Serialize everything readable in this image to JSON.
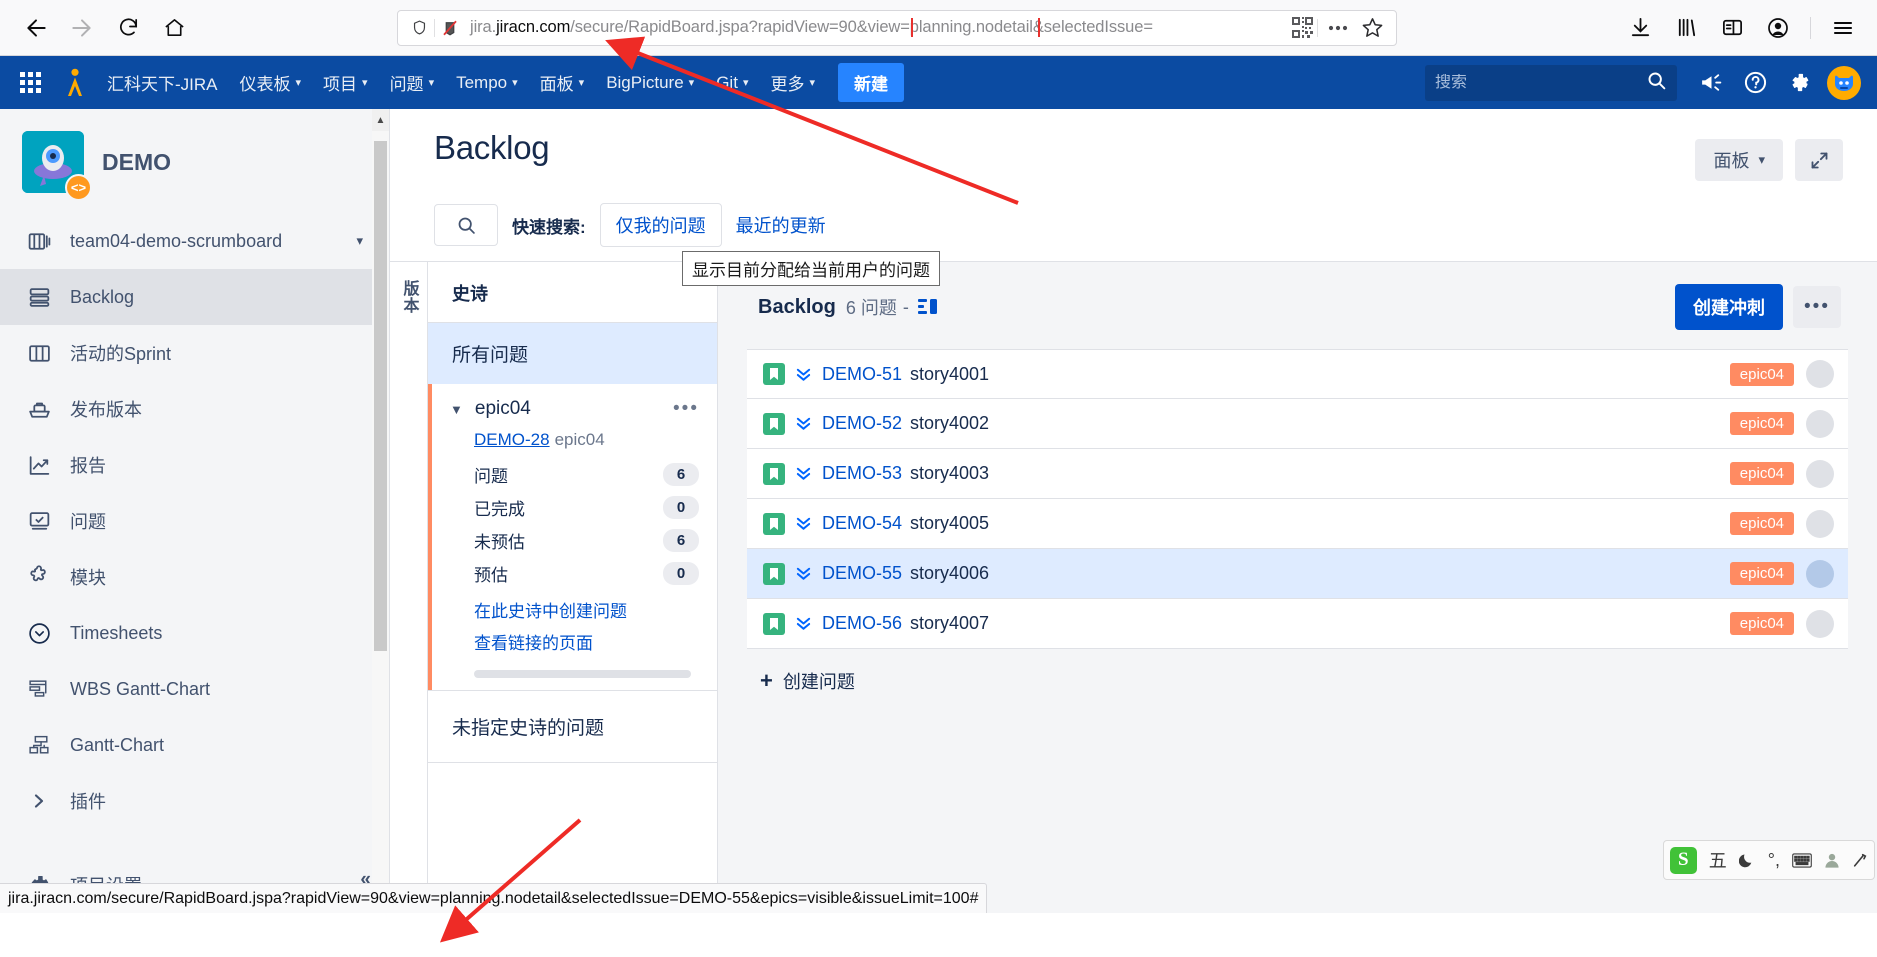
{
  "browser": {
    "back_title": "Back",
    "forward_title": "Forward",
    "reload_title": "Reload",
    "home_title": "Home",
    "url_full": "jira.jiracn.com/secure/RapidBoard.jspa?rapidView=90&view=planning.nodetail&selectedIssue=",
    "url_host_prefix": "jira.",
    "url_host_bold": "jiracn.com",
    "url_path": "/secure/RapidBoard.jspa?",
    "url_highlighted": "rapidView=90&",
    "url_tail": "view=planning.nodetail&selectedIssue=",
    "highlight_color": "#e8302d",
    "shield_title": "Tracking protection",
    "qr_title": "QR code",
    "more_title": "Page actions",
    "bookmark_title": "Bookmark this page",
    "downloads_title": "Downloads",
    "library_title": "Library",
    "sidebar_title": "Sidebar",
    "account_title": "Account",
    "menu_title": "Open application menu"
  },
  "jira_nav": {
    "brand": "汇科天下-JIRA",
    "items": [
      {
        "label": "仪表板",
        "has_caret": true
      },
      {
        "label": "项目",
        "has_caret": true
      },
      {
        "label": "问题",
        "has_caret": true
      },
      {
        "label": "Tempo",
        "has_caret": true
      },
      {
        "label": "面板",
        "has_caret": true
      },
      {
        "label": "BigPicture",
        "has_caret": true
      },
      {
        "label": "Git",
        "has_caret": true
      },
      {
        "label": "更多",
        "has_caret": true
      }
    ],
    "create_button": "新建",
    "search_placeholder": "搜索",
    "search_value": "",
    "icons": [
      "megaphone-icon",
      "help-icon",
      "gear-icon",
      "avatar"
    ],
    "bg_color": "#0b4ba2",
    "create_color": "#2684ff"
  },
  "sidebar": {
    "project_name": "DEMO",
    "board_selector": "team04-demo-scrumboard",
    "items": [
      {
        "label": "Backlog",
        "icon": "backlog-icon",
        "selected": true
      },
      {
        "label": "活动的Sprint",
        "icon": "board-icon",
        "selected": false
      },
      {
        "label": "发布版本",
        "icon": "releases-icon",
        "selected": false
      },
      {
        "label": "报告",
        "icon": "reports-icon",
        "selected": false
      },
      {
        "label": "问题",
        "icon": "issues-icon",
        "selected": false
      },
      {
        "label": "模块",
        "icon": "components-icon",
        "selected": false
      },
      {
        "label": "Timesheets",
        "icon": "clock-icon",
        "selected": false
      },
      {
        "label": "WBS Gantt-Chart",
        "icon": "wbs-gantt-icon",
        "selected": false
      },
      {
        "label": "Gantt-Chart",
        "icon": "gantt-icon",
        "selected": false
      },
      {
        "label": "插件",
        "icon": "chevron-right-icon",
        "selected": false
      }
    ],
    "settings_label": "项目设置",
    "collapse_label": "«"
  },
  "main": {
    "page_title": "Backlog",
    "board_button": "面板",
    "expand_title": "全屏",
    "quick_search_label": "快速搜索:",
    "chip_only_my_issues": "仅我的问题",
    "link_recently_updated": "最近的更新",
    "tooltip": "显示目前分配给当前用户的问题",
    "search_placeholder": ""
  },
  "epic_panel": {
    "rail_label": "版本",
    "title": "史诗",
    "all_issues": "所有问题",
    "epic": {
      "name": "epic04",
      "key": "DEMO-28",
      "summary": "epic04",
      "stats": [
        {
          "label": "问题",
          "value": "6"
        },
        {
          "label": "已完成",
          "value": "0"
        },
        {
          "label": "未预估",
          "value": "6"
        },
        {
          "label": "预估",
          "value": "0"
        }
      ],
      "create_in_epic": "在此史诗中创建问题",
      "view_linked_pages": "查看链接的页面",
      "color": "#ff8b62"
    },
    "unassigned_label": "未指定史诗的问题"
  },
  "backlog": {
    "title": "Backlog",
    "count_text": "6 问题",
    "separator": "-",
    "create_sprint_button": "创建冲刺",
    "more_button": "•••",
    "create_issue": "创建问题",
    "issues": [
      {
        "key": "DEMO-51",
        "summary": "story4001",
        "epic": "epic04",
        "selected": false,
        "type": "story"
      },
      {
        "key": "DEMO-52",
        "summary": "story4002",
        "epic": "epic04",
        "selected": false,
        "type": "story"
      },
      {
        "key": "DEMO-53",
        "summary": "story4003",
        "epic": "epic04",
        "selected": false,
        "type": "story"
      },
      {
        "key": "DEMO-54",
        "summary": "story4005",
        "epic": "epic04",
        "selected": false,
        "type": "story"
      },
      {
        "key": "DEMO-55",
        "summary": "story4006",
        "epic": "epic04",
        "selected": true,
        "type": "story"
      },
      {
        "key": "DEMO-56",
        "summary": "story4007",
        "epic": "epic04",
        "selected": false,
        "type": "story"
      }
    ]
  },
  "ime": {
    "logo": "S",
    "mode": "五",
    "items": [
      "moon-icon",
      "punctuation-icon",
      "keyboard-icon",
      "person-icon",
      "tools-icon"
    ]
  },
  "statusbar": {
    "link_url": "jira.jiracn.com/secure/RapidBoard.jspa?rapidView=90&view=planning.nodetail&selectedIssue=DEMO-55&epics=visible&issueLimit=100#"
  }
}
